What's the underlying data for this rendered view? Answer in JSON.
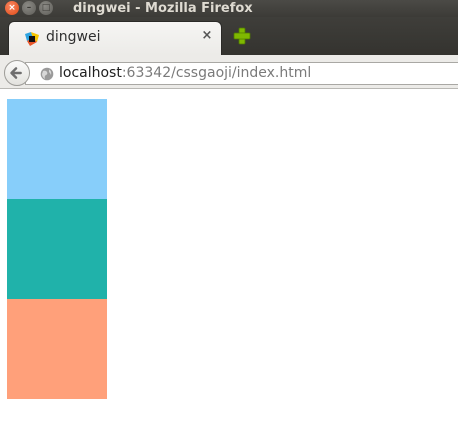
{
  "window": {
    "title": "dingwei - Mozilla Firefox",
    "controls": {
      "close": "×",
      "minimize": "–",
      "maximize": "□"
    }
  },
  "tabs": [
    {
      "label": "dingwei",
      "close_icon": "×",
      "active": true
    }
  ],
  "navbar": {
    "url_host": "localhost",
    "url_rest": ":63342/cssgaoji/index.html"
  },
  "page": {
    "boxes": [
      {
        "color": "#87cefa"
      },
      {
        "color": "#20b2aa"
      },
      {
        "color": "#ffa07a"
      }
    ]
  },
  "colors": {
    "titlebar": "#3c3b37",
    "close_button": "#df4a16",
    "newtab_plus": "#7fb800"
  }
}
